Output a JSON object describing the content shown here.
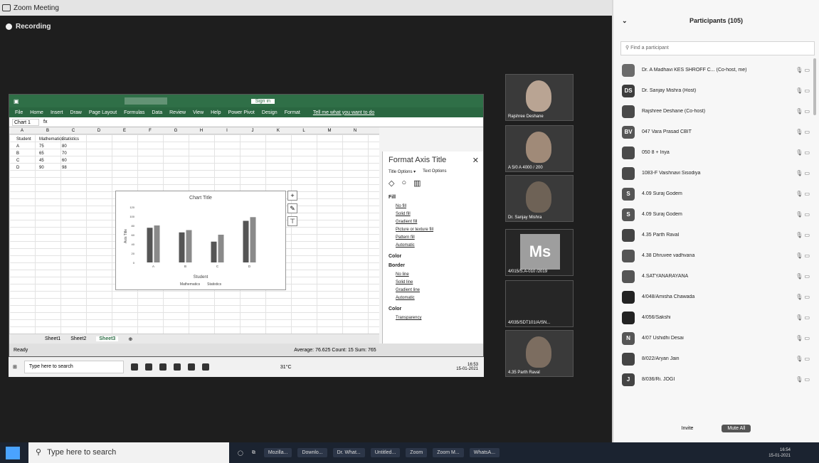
{
  "window": {
    "title": "Zoom Meeting",
    "controls": [
      "–",
      "▢",
      "✕"
    ]
  },
  "recording": {
    "label": "Recording"
  },
  "excel": {
    "ribbon_tabs": [
      "File",
      "Home",
      "Insert",
      "Draw",
      "Page Layout",
      "Formulas",
      "Data",
      "Review",
      "View",
      "Help",
      "Power Pivot",
      "Design",
      "Format"
    ],
    "tell_me": "Tell me what you want to do",
    "signin": "Sign in",
    "namebox": "Chart 1",
    "fx": "fx",
    "columns": [
      "A",
      "B",
      "C",
      "D",
      "E",
      "F",
      "G",
      "H",
      "I",
      "J",
      "K",
      "L",
      "M",
      "N"
    ],
    "table": {
      "headers": [
        "Student",
        "Mathematics",
        "Statistics"
      ],
      "rows": [
        [
          "A",
          "75",
          "80"
        ],
        [
          "B",
          "65",
          "70"
        ],
        [
          "C",
          "45",
          "60"
        ],
        [
          "D",
          "90",
          "98"
        ]
      ]
    },
    "sheets": [
      "Sheet1",
      "Sheet2",
      "Sheet3"
    ],
    "active_sheet": "Sheet3",
    "status": "Ready",
    "status_right": "Average: 76.625    Count: 15    Sum: 765"
  },
  "chart": {
    "title": "Chart Title",
    "xlabel": "Student",
    "ylabel": "Axis Title",
    "legend": [
      "Mathematics",
      "Statistics"
    ],
    "tools": [
      "+",
      "✎",
      "⊤"
    ]
  },
  "chart_data": {
    "type": "bar",
    "categories": [
      "A",
      "B",
      "C",
      "D"
    ],
    "series": [
      {
        "name": "Mathematics",
        "values": [
          75,
          65,
          45,
          90
        ]
      },
      {
        "name": "Statistics",
        "values": [
          80,
          70,
          60,
          98
        ]
      }
    ],
    "title": "Chart Title",
    "xlabel": "Student",
    "ylabel": "Axis Title",
    "ylim": [
      0,
      120
    ],
    "legend": "bottom",
    "colors": [
      "#555555",
      "#8a8a8a"
    ]
  },
  "format_pane": {
    "title": "Format Axis Title",
    "tabs": [
      "Title Options ▾",
      "Text Options"
    ],
    "fill_section": "Fill",
    "fill_options": [
      "No fill",
      "Solid fill",
      "Gradient fill",
      "Picture or texture fill",
      "Pattern fill",
      "Automatic"
    ],
    "color_label": "Color",
    "border_section": "Border",
    "border_options": [
      "No line",
      "Solid line",
      "Gradient line",
      "Automatic"
    ],
    "transparency_label": "Transparency"
  },
  "inner_taskbar": {
    "search": "Type here to search",
    "temp": "31°C",
    "time": "16:53",
    "date": "15-01-2021"
  },
  "videos": [
    {
      "name": "Rajshree Deshane"
    },
    {
      "name": "A 5/0 A 4000 / 200"
    },
    {
      "name": "Dr. Sanjay Mishra"
    },
    {
      "name": "4/015/S.A-010 /2019",
      "initials": "Ms"
    },
    {
      "name": "4/035/SDT101/A/SN..."
    },
    {
      "name": "4.35 Parth Raval"
    }
  ],
  "participants": {
    "header": "Participants (105)",
    "find_placeholder": "Find a participant",
    "list": [
      {
        "name": "Dr. A Madhavi KES SHROFF C... (Co-host, me)",
        "avatar": "",
        "color": "#6b6b6b"
      },
      {
        "name": "Dr. Sanjay Mishra (Host)",
        "avatar": "DS",
        "color": "#3d3d3d"
      },
      {
        "name": "Rajshree Deshane (Co-host)",
        "avatar": "",
        "color": "#4a4a4a"
      },
      {
        "name": "047 Vara Prasad CBIT",
        "avatar": "BV",
        "color": "#555555"
      },
      {
        "name": "050 8 + Inya",
        "avatar": "",
        "color": "#4a4a4a"
      },
      {
        "name": "1083-F Vaishnavi Sisodiya",
        "avatar": "",
        "color": "#4a4a4a"
      },
      {
        "name": "4.09 Suraj Godem",
        "avatar": "S",
        "color": "#555555"
      },
      {
        "name": "4.09 Suraj Godem",
        "avatar": "S",
        "color": "#555555"
      },
      {
        "name": "4.35 Parth Raval",
        "avatar": "",
        "color": "#444444"
      },
      {
        "name": "4.38 Dhruvee vadhvana",
        "avatar": "",
        "color": "#555555"
      },
      {
        "name": "4.SATYANARAYANA",
        "avatar": "",
        "color": "#555555"
      },
      {
        "name": "4/048/Amisha Chawada",
        "avatar": "",
        "color": "#222222"
      },
      {
        "name": "4/056/Sakshi",
        "avatar": "",
        "color": "#222222"
      },
      {
        "name": "4/07 Ushidhi Desai",
        "avatar": "N",
        "color": "#555555"
      },
      {
        "name": "8/022/Aryan Jain",
        "avatar": "",
        "color": "#444444"
      },
      {
        "name": "8/036/Ri. JOGI",
        "avatar": "J",
        "color": "#444444"
      }
    ],
    "footer_invite": "Invite",
    "footer_more": "Mute All"
  },
  "taskbar": {
    "search": "Type here to search",
    "apps": [
      "Mozilla...",
      "Downlo...",
      "Dr. What...",
      "Untitled...",
      "Zoom",
      "Zoom M...",
      "WhatsA..."
    ],
    "time": "16:54",
    "date": "15-01-2021"
  }
}
